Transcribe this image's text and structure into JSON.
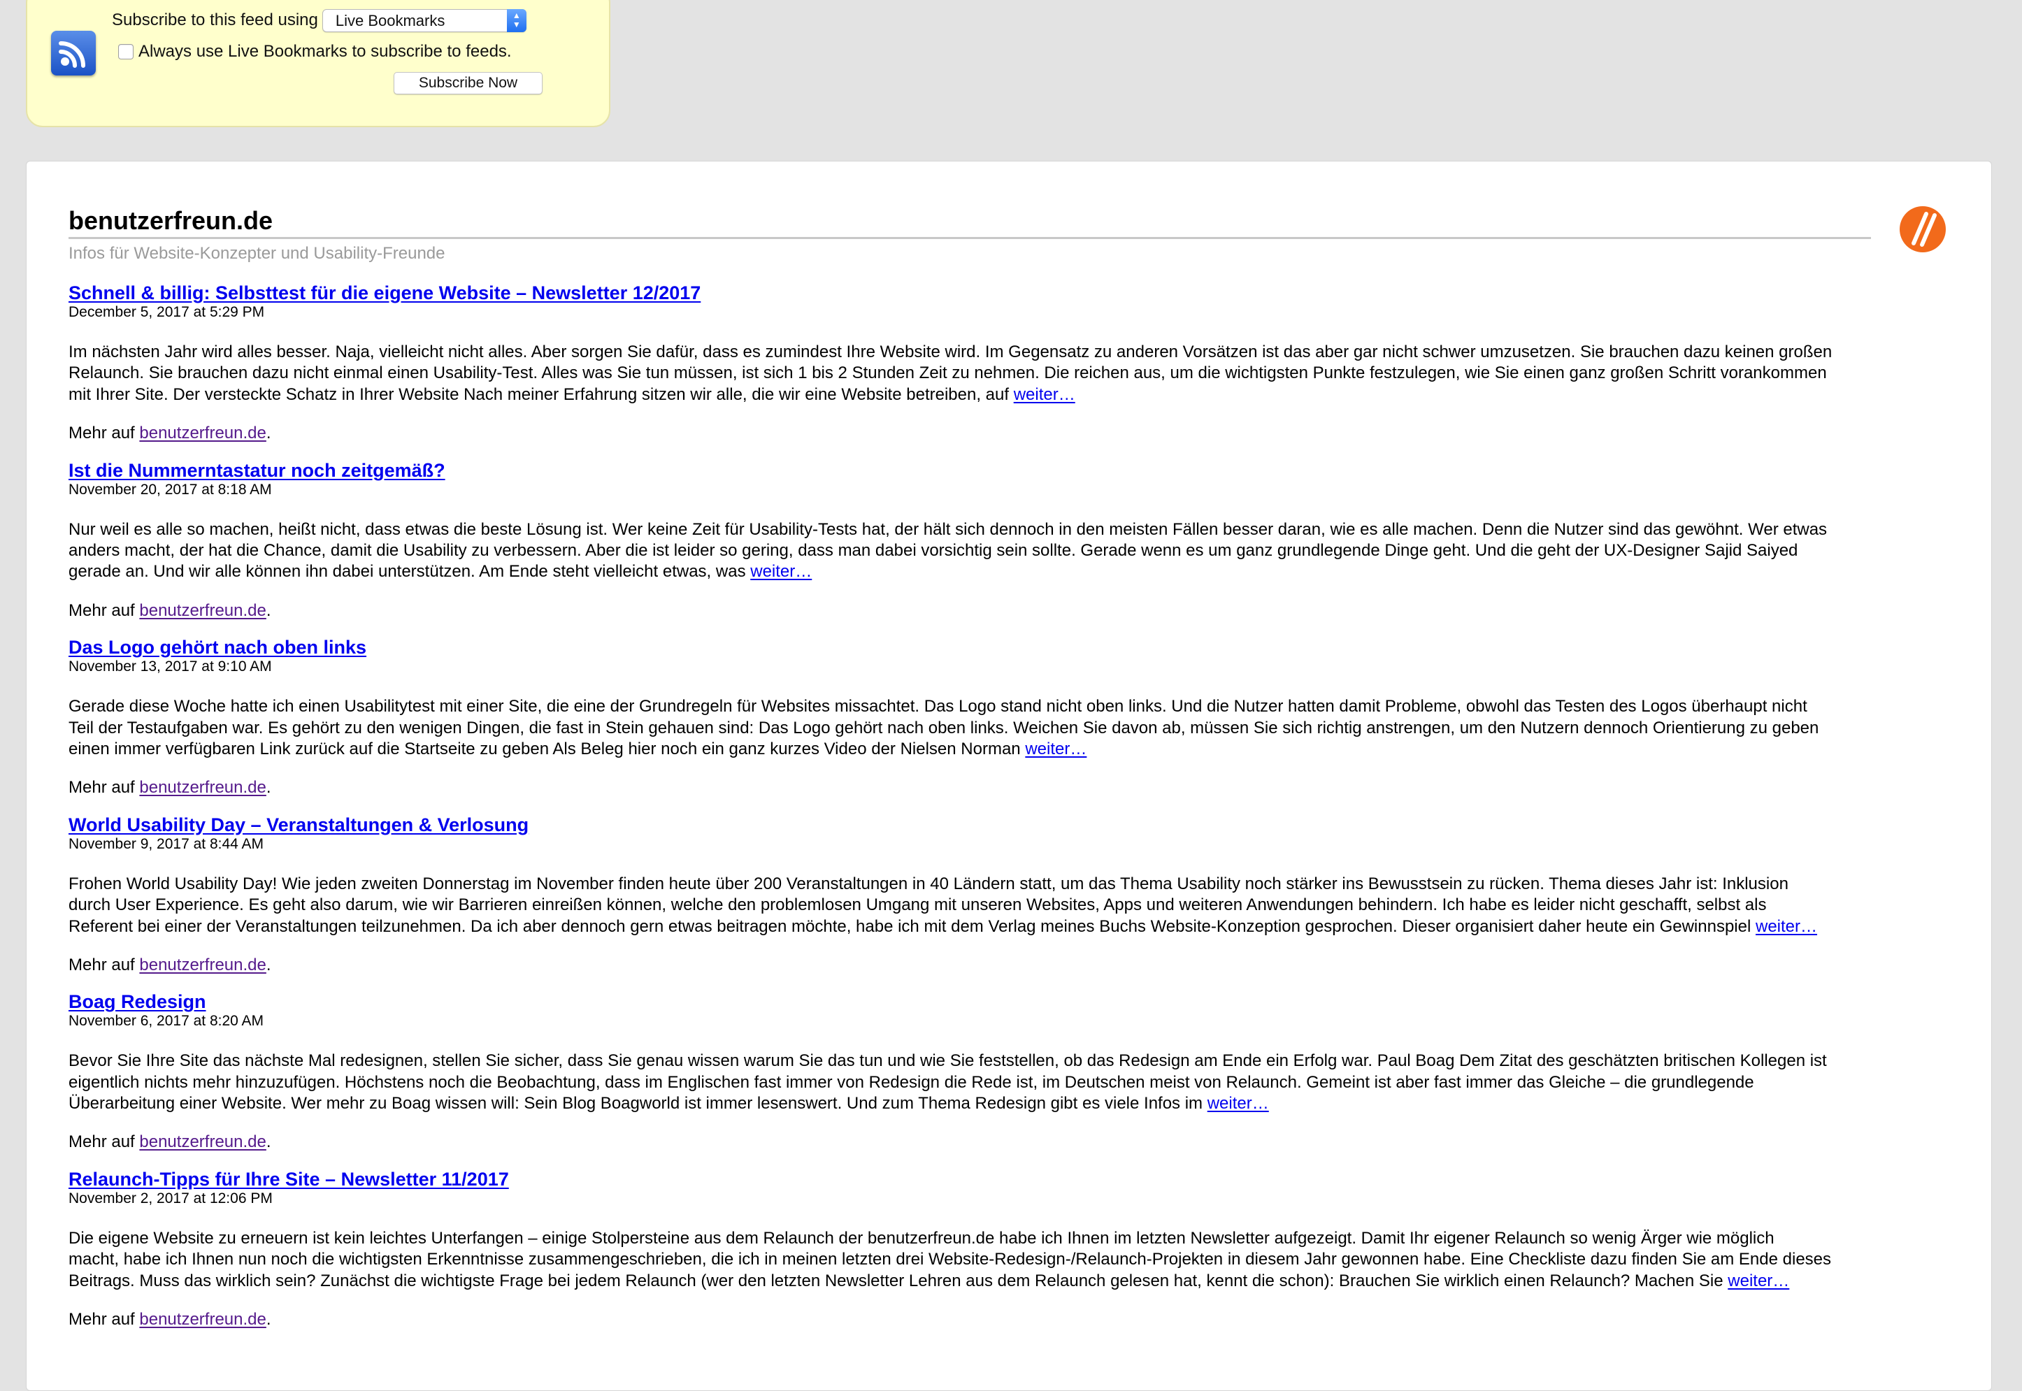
{
  "subscribe": {
    "label": "Subscribe to this feed using",
    "reader_selected": "Live Bookmarks",
    "always_use_label": "Always use Live Bookmarks to subscribe to feeds.",
    "always_use_checked": false,
    "button_label": "Subscribe Now",
    "icon": "rss-feed-icon"
  },
  "feed": {
    "title": "benutzerfreun.de",
    "subtitle": "Infos für Website-Konzepter und Usability-Freunde",
    "logo_icon": "site-logo-icon",
    "logo_color": "#f26a1b"
  },
  "entries": [
    {
      "title": "Schnell & billig: Selbsttest für die eigene Website – Newsletter 12/2017",
      "date": "December 5, 2017 at 5:29 PM",
      "body": "Im nächsten Jahr wird alles besser. Naja, vielleicht nicht alles. Aber sorgen Sie dafür, dass es zumindest Ihre Website wird. Im Gegensatz zu anderen Vorsätzen ist das aber gar nicht schwer umzusetzen. Sie brauchen dazu keinen großen\nRelaunch. Sie brauchen dazu nicht einmal einen Usability-Test. Alles was Sie tun müssen, ist sich 1 bis 2 Stunden Zeit zu nehmen. Die reichen aus, um die wichtigsten Punkte festzulegen, wie Sie einen ganz großen Schritt vorankommen\nmit Ihrer Site. Der versteckte Schatz in Ihrer Website Nach meiner Erfahrung sitzen wir alle, die wir eine Website betreiben, auf ",
      "more_link": " weiter…",
      "more_prefix": "Mehr auf ",
      "source": "benutzerfreun.de",
      "more_suffix": "."
    },
    {
      "title": "Ist die Nummerntastatur noch zeitgemäß?",
      "date": "November 20, 2017 at 8:18 AM",
      "body": "Nur weil es alle so machen, heißt nicht, dass etwas die beste Lösung ist. Wer keine Zeit für Usability-Tests hat, der hält sich dennoch in den meisten Fällen besser daran, wie es alle machen. Denn die Nutzer sind das gewöhnt. Wer etwas\nanders macht, der hat die Chance, damit die Usability zu verbessern. Aber die ist leider so gering, dass man dabei vorsichtig sein sollte. Gerade wenn es um ganz grundlegende Dinge geht. Und die geht der UX-Designer Sajid Saiyed\ngerade an. Und wir alle können ihn dabei unterstützen. Am Ende steht vielleicht etwas, was ",
      "more_link": " weiter…",
      "more_prefix": "Mehr auf ",
      "source": "benutzerfreun.de",
      "more_suffix": "."
    },
    {
      "title": "Das Logo gehört nach oben links",
      "date": "November 13, 2017 at 9:10 AM",
      "body": "Gerade diese Woche hatte ich einen Usabilitytest mit einer Site, die eine der Grundregeln für Websites missachtet. Das Logo stand nicht oben links. Und die Nutzer hatten damit Probleme, obwohl das Testen des Logos überhaupt nicht\nTeil der Testaufgaben war. Es gehört zu den wenigen Dingen, die fast in Stein gehauen sind: Das Logo gehört nach oben links. Weichen Sie davon ab, müssen Sie sich richtig anstrengen, um den Nutzern dennoch Orientierung zu geben\neinen immer verfügbaren Link zurück auf die Startseite zu geben Als Beleg hier noch ein ganz kurzes Video der Nielsen Norman ",
      "more_link": " weiter…",
      "more_prefix": "Mehr auf ",
      "source": "benutzerfreun.de",
      "more_suffix": "."
    },
    {
      "title": "World Usability Day – Veranstaltungen & Verlosung",
      "date": "November 9, 2017 at 8:44 AM",
      "body": "Frohen World Usability Day! Wie jeden zweiten Donnerstag im November finden heute über 200 Veranstaltungen in 40 Ländern statt, um das Thema Usability noch stärker ins Bewusstsein zu rücken. Thema dieses Jahr ist: Inklusion\ndurch User Experience. Es geht also darum, wie wir Barrieren einreißen können, welche den problemlosen Umgang mit unseren Websites, Apps und weiteren Anwendungen behindern. Ich habe es leider nicht geschafft, selbst als\nReferent bei einer der Veranstaltungen teilzunehmen. Da ich aber dennoch gern etwas beitragen möchte, habe ich mit dem Verlag meines Buchs Website-Konzeption gesprochen. Dieser organisiert daher heute ein Gewinnspiel ",
      "more_link": " weiter…",
      "more_prefix": "Mehr auf ",
      "source": "benutzerfreun.de",
      "more_suffix": "."
    },
    {
      "title": "Boag Redesign",
      "date": "November 6, 2017 at 8:20 AM",
      "body": "Bevor Sie Ihre Site das nächste Mal redesignen, stellen Sie sicher, dass Sie genau wissen warum Sie das tun und wie Sie feststellen, ob das Redesign am Ende ein Erfolg war. Paul Boag Dem Zitat des geschätzten britischen Kollegen ist\neigentlich nichts mehr hinzuzufügen. Höchstens noch die Beobachtung, dass im Englischen fast immer von Redesign die Rede ist, im Deutschen meist von Relaunch. Gemeint ist aber fast immer das Gleiche – die grundlegende\nÜberarbeitung einer Website. Wer mehr zu Boag wissen will: Sein Blog Boagworld ist immer lesenswert. Und zum Thema Redesign gibt es viele Infos im ",
      "more_link": " weiter…",
      "more_prefix": "Mehr auf ",
      "source": "benutzerfreun.de",
      "more_suffix": "."
    },
    {
      "title": "Relaunch-Tipps für Ihre Site – Newsletter 11/2017",
      "date": "November 2, 2017 at 12:06 PM",
      "body": "Die eigene Website zu erneuern ist kein leichtes Unterfangen – einige Stolpersteine aus dem Relaunch der benutzerfreun.de habe ich Ihnen im letzten Newsletter aufgezeigt. Damit Ihr eigener Relaunch so wenig Ärger wie möglich\nmacht, habe ich Ihnen nun noch die wichtigsten Erkenntnisse zusammengeschrieben, die ich in meinen letzten drei Website-Redesign-/Relaunch-Projekten in diesem Jahr gewonnen habe. Eine Checkliste dazu finden Sie am Ende dieses\nBeitrags. Muss das wirklich sein? Zunächst die wichtigste Frage bei jedem Relaunch (wer den letzten Newsletter Lehren aus dem Relaunch gelesen hat, kennt die schon): Brauchen Sie wirklich einen Relaunch? Machen Sie ",
      "more_link": " weiter…",
      "more_prefix": "Mehr auf ",
      "source": "benutzerfreun.de",
      "more_suffix": "."
    }
  ]
}
